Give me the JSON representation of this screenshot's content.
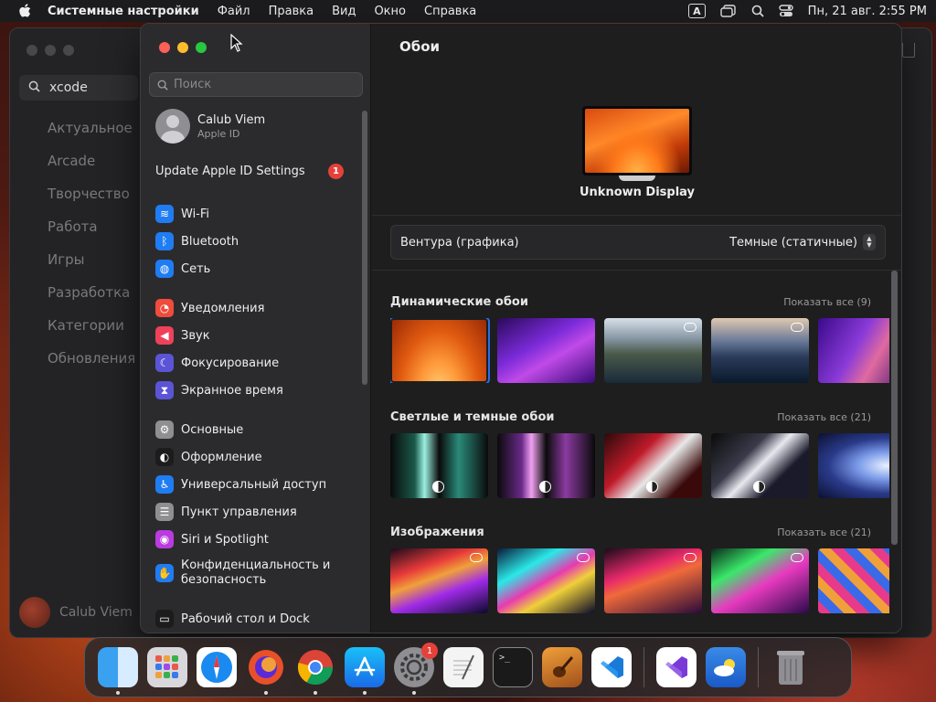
{
  "menubar": {
    "app_name": "Системные настройки",
    "menus": [
      "Файл",
      "Правка",
      "Вид",
      "Окно",
      "Справка"
    ],
    "input_badge": "A",
    "clock": "Пн, 21 авг.  2:55 PM"
  },
  "background_window": {
    "search_value": "xcode",
    "nav": [
      "Актуальное",
      "Arcade",
      "Творчество",
      "Работа",
      "Игры",
      "Разработка",
      "Категории",
      "Обновления"
    ],
    "user_name": "Calub Viem"
  },
  "sidebar": {
    "search_placeholder": "Поиск",
    "user": {
      "name": "Calub Viem",
      "subtitle": "Apple ID"
    },
    "update_label": "Update Apple ID Settings",
    "update_badge": "1",
    "items": [
      {
        "label": "Wi-Fi",
        "icon": "wifi-icon",
        "color": "#1f7cf2",
        "glyph": "≋"
      },
      {
        "label": "Bluetooth",
        "icon": "bluetooth-icon",
        "color": "#1f7cf2",
        "glyph": "ᛒ"
      },
      {
        "label": "Сеть",
        "icon": "globe-icon",
        "color": "#1f7cf2",
        "glyph": "◍"
      },
      {
        "label": "Уведомления",
        "icon": "bell-icon",
        "color": "#f04b3c",
        "glyph": "◔"
      },
      {
        "label": "Звук",
        "icon": "speaker-icon",
        "color": "#f0415a",
        "glyph": "◀"
      },
      {
        "label": "Фокусирование",
        "icon": "moon-icon",
        "color": "#5b54d6",
        "glyph": "☾"
      },
      {
        "label": "Экранное время",
        "icon": "hourglass-icon",
        "color": "#5b54d6",
        "glyph": "⧗"
      },
      {
        "label": "Основные",
        "icon": "gear-icon",
        "color": "#8e8e93",
        "glyph": "⚙"
      },
      {
        "label": "Оформление",
        "icon": "appearance-icon",
        "color": "#1c1c1c",
        "glyph": "◐"
      },
      {
        "label": "Универсальный доступ",
        "icon": "accessibility-icon",
        "color": "#1f7cf2",
        "glyph": "♿"
      },
      {
        "label": "Пункт управления",
        "icon": "control-center-icon",
        "color": "#8e8e93",
        "glyph": "☰"
      },
      {
        "label": "Siri и Spotlight",
        "icon": "siri-icon",
        "color": "#b93ce0",
        "glyph": "◉"
      },
      {
        "label": "Конфиденциальность и безопасность",
        "icon": "hand-icon",
        "color": "#1f7cf2",
        "glyph": "✋"
      },
      {
        "label": "Рабочий стол и Dock",
        "icon": "dock-icon",
        "color": "#1c1c1c",
        "glyph": "▭"
      }
    ]
  },
  "main": {
    "title": "Обои",
    "display_name": "Unknown Display",
    "wallpaper_name": "Вентура (графика)",
    "wallpaper_mode": "Темные (статичные)",
    "sections": [
      {
        "title": "Динамические обои",
        "show_all": "Показать все (9)"
      },
      {
        "title": "Светлые и темные обои",
        "show_all": "Показать все (21)"
      },
      {
        "title": "Изображения",
        "show_all": "Показать все (21)"
      }
    ]
  },
  "dock": {
    "settings_badge": "1",
    "apps": [
      "finder",
      "launchpad",
      "safari",
      "firefox",
      "chrome",
      "app-store",
      "system-settings",
      "textedit",
      "terminal",
      "garageband",
      "vscode",
      "visual-studio",
      "weather",
      "trash"
    ]
  },
  "colors": {
    "accent": "#2b6de8",
    "badge": "#e5413a",
    "close": "#fe5f57",
    "minimize": "#febc2e",
    "zoom": "#28c840"
  }
}
